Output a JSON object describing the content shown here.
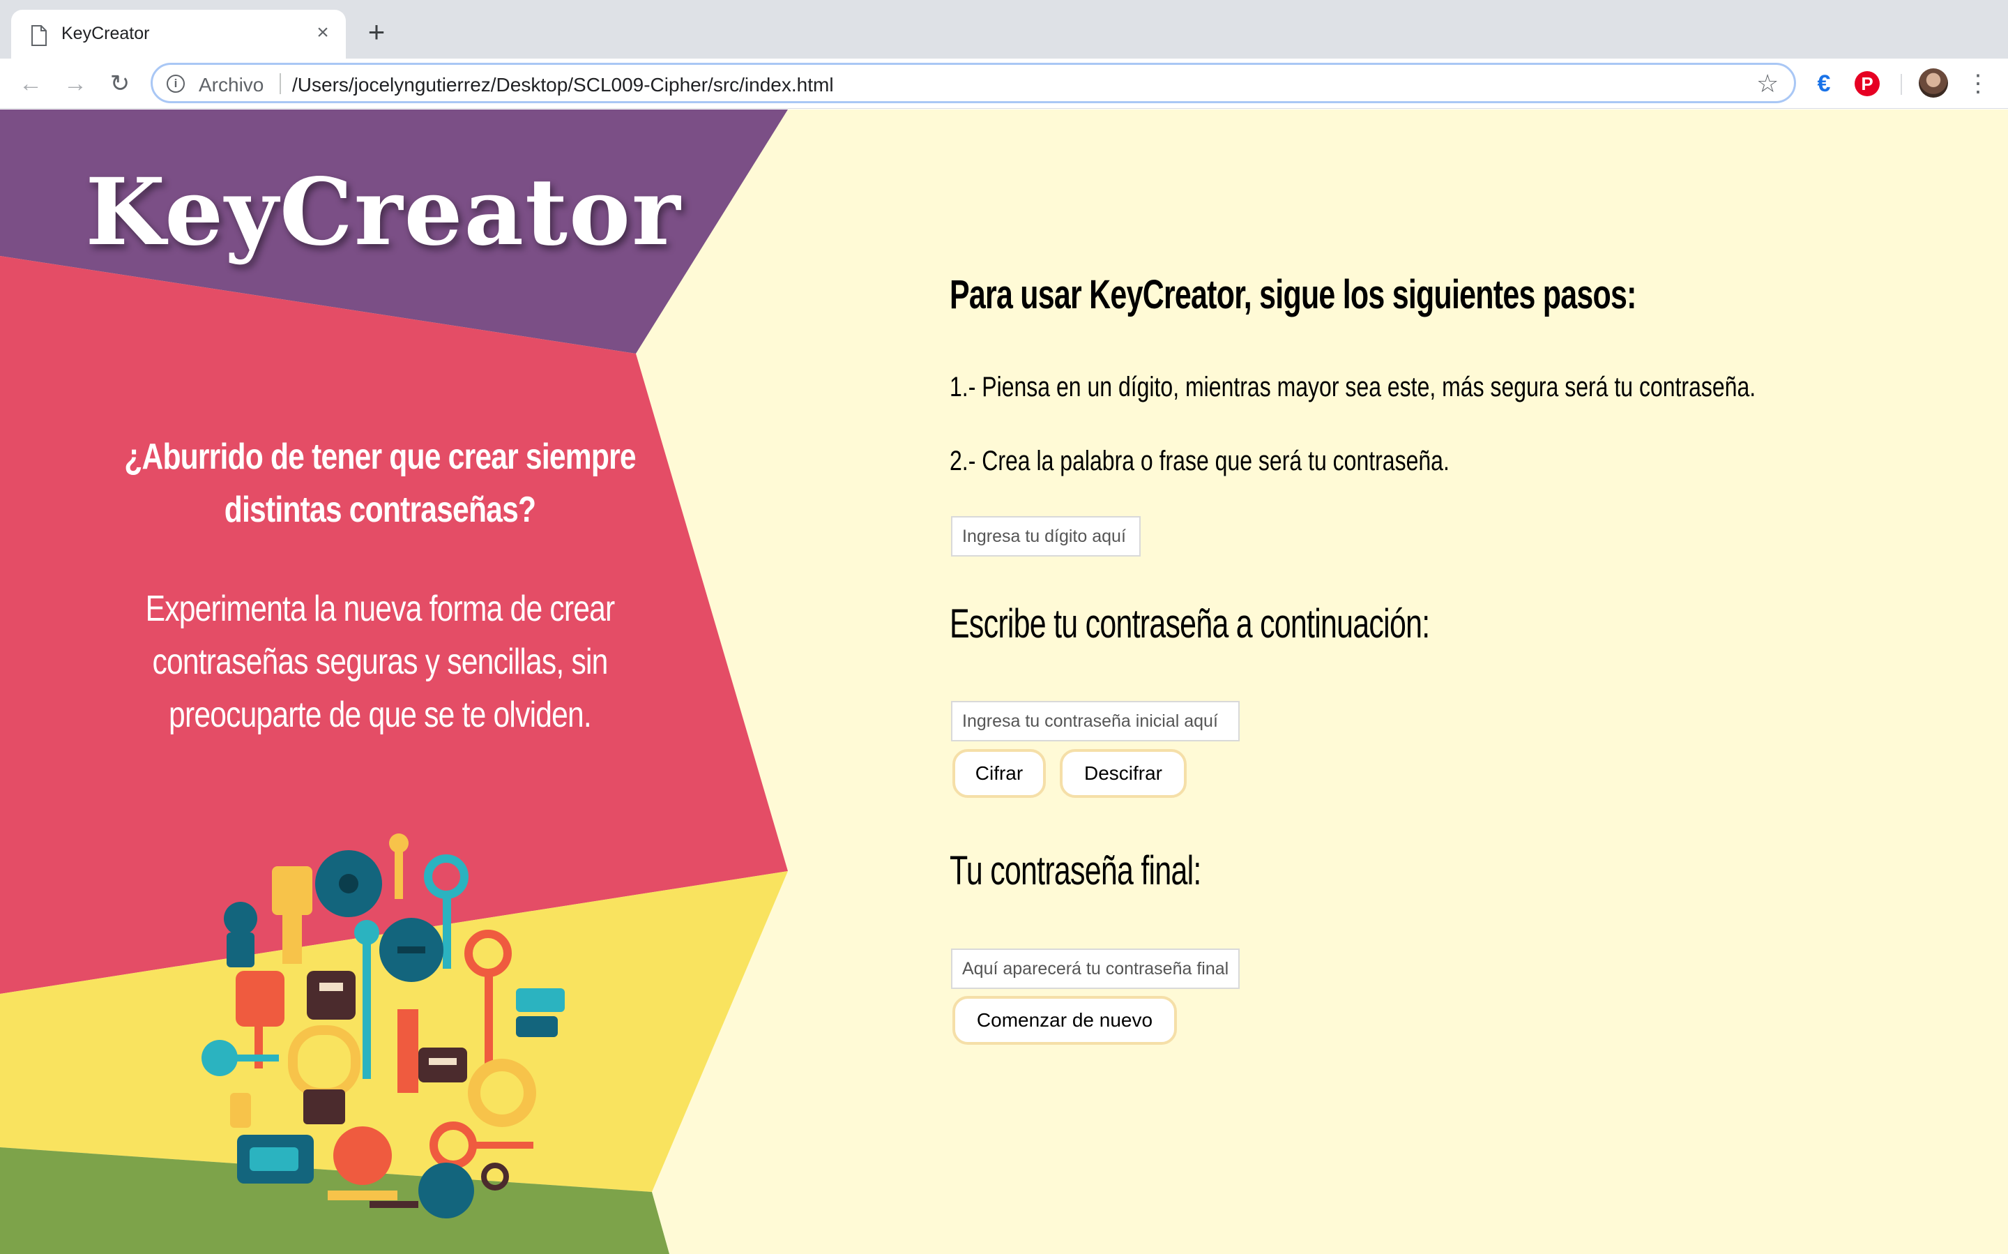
{
  "browser": {
    "tab_title": "KeyCreator",
    "new_tab_symbol": "+",
    "address_label": "Archivo",
    "address_url": "/Users/jocelyngutierrez/Desktop/SCL009-Cipher/src/index.html"
  },
  "page": {
    "logo": "KeyCreator",
    "promo_question": "¿Aburrido de tener que crear siempre distintas contraseñas?",
    "promo_text": "Experimenta la nueva forma de crear contraseñas seguras y sencillas, sin preocuparte de que se te olviden.",
    "heading_main": "Para usar KeyCreator, sigue los siguientes pasos:",
    "step_1": "1.- Piensa en un dígito, mientras mayor sea este, más segura será tu contraseña.",
    "step_2": "2.- Crea la palabra o frase que será tu contraseña.",
    "digit_placeholder": "Ingresa tu dígito aquí",
    "heading_password": "Escribe tu contraseña a continuación:",
    "password_placeholder": "Ingresa tu contraseña inicial aquí",
    "btn_cifrar": "Cifrar",
    "btn_descifrar": "Descifrar",
    "heading_final": "Tu contraseña final:",
    "final_placeholder": "Aquí aparecerá tu contraseña final",
    "btn_restart": "Comenzar de nuevo"
  },
  "colors": {
    "purple": "#7b4f86",
    "red": "#e44d66",
    "yellow": "#f9e35f",
    "green": "#7da34a",
    "cream": "#fffad6"
  }
}
